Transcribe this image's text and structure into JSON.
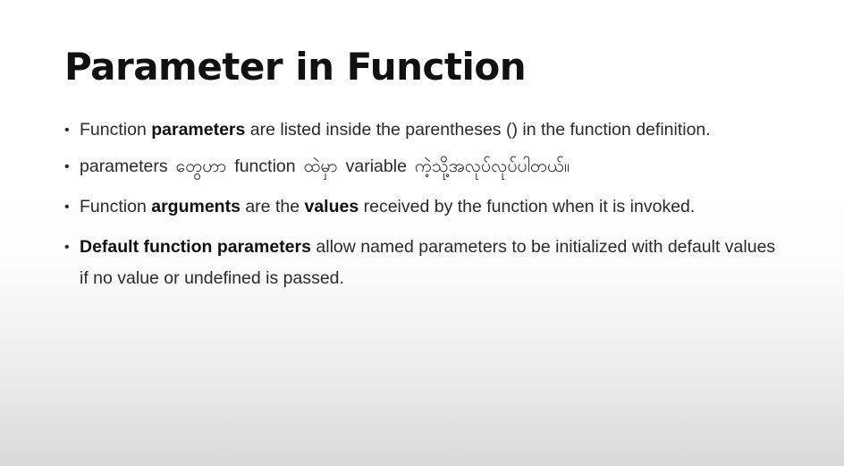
{
  "slide": {
    "title": "Parameter in Function",
    "bullets": [
      {
        "parts": [
          "Function ",
          "parameters",
          " are listed inside the parentheses () in the function definition."
        ]
      },
      {
        "parts": [
          "parameters",
          "တွေဟာ",
          "function",
          "ထဲမှာ",
          "variable",
          "ကဲ့သို့အလုပ်လုပ်ပါတယ်။"
        ]
      },
      {
        "parts": [
          "Function ",
          "arguments",
          " are the ",
          "values",
          " received by the function when it is invoked."
        ]
      },
      {
        "parts": [
          "Default function parameters",
          " allow named parameters to be initialized with default values if no value or undefined is passed."
        ]
      }
    ]
  },
  "icons": {
    "bullet": "•"
  }
}
